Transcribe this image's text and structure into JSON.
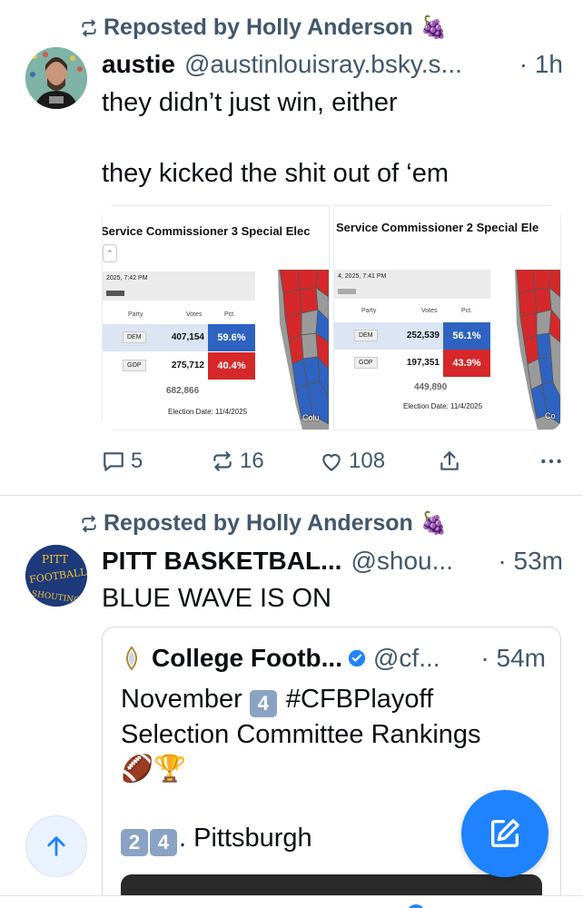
{
  "posts": [
    {
      "repost_label": "Reposted by Holly Anderson",
      "repost_emoji": "🍇",
      "author_name": "austie",
      "author_handle": "@austinlouisray.bsky.s...",
      "time": "· 1h",
      "text": "they didn’t just win, either\n\nthey kicked the shit out of ‘em",
      "images": [
        {
          "title": "Service Commissioner 3 Special Elec",
          "date_text": "2025, 7:42 PM",
          "col_party": "Party",
          "col_votes": "Votes",
          "col_pct": "Pct.",
          "rows": [
            {
              "party": "DEM",
              "votes": "407,154",
              "pct": "59.6%"
            },
            {
              "party": "GOP",
              "votes": "275,712",
              "pct": "40.4%"
            }
          ],
          "total": "682,866",
          "election_date": "Election Date: 11/4/2025",
          "map_label": "Colu"
        },
        {
          "title": "Service Commissioner 2 Special Ele",
          "date_text": "4, 2025, 7:41 PM",
          "col_party": "Party",
          "col_votes": "Votes",
          "col_pct": "Pct.",
          "rows": [
            {
              "party": "DEM",
              "votes": "252,539",
              "pct": "56.1%"
            },
            {
              "party": "GOP",
              "votes": "197,351",
              "pct": "43.9%"
            }
          ],
          "total": "449,890",
          "election_date": "Election Date: 11/4/2025",
          "map_label": "Co"
        }
      ],
      "replies": "5",
      "reposts": "16",
      "likes": "108"
    },
    {
      "repost_label": "Reposted by Holly Anderson",
      "repost_emoji": "🍇",
      "author_name": "PITT BASKETBAL...",
      "author_handle": "@shou...",
      "time": "· 53m",
      "text": "BLUE WAVE IS ON",
      "avatar_text": [
        "PITT",
        "FOOTBALL",
        "SHOUTING"
      ],
      "quote": {
        "author_name": "College Footb...",
        "author_handle": "@cf...",
        "time": "· 54m",
        "line1_pre": "November ",
        "line1_key": "4",
        "line1_post": " #CFBPlayoff",
        "line2": "Selection Committee Rankings",
        "line3": "🏈🏆",
        "line4_key1": "2",
        "line4_key2": "4",
        "line4_post": ". Pittsburgh"
      }
    }
  ],
  "colors": {
    "accent": "#1f83ff",
    "muted_text": "#42576c",
    "dem": "#2f63c2",
    "gop": "#d6282a"
  }
}
